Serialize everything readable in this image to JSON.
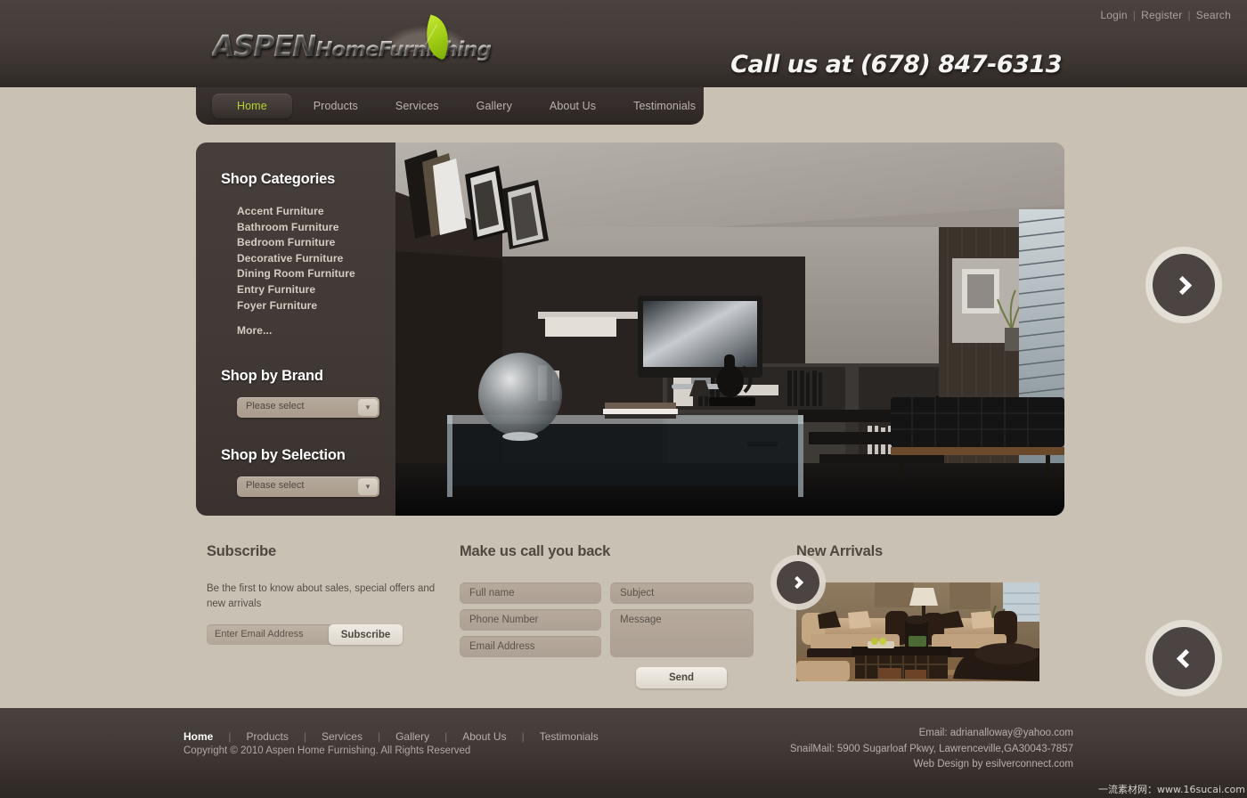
{
  "header": {
    "util_links": [
      {
        "label": "Login"
      },
      {
        "label": "Register"
      },
      {
        "label": "Search"
      }
    ],
    "separator": "|",
    "logo": {
      "primary": "ASPEN",
      "secondary": "HomeFurnishing"
    },
    "phone": "Call us at (678) 847-6313"
  },
  "nav": {
    "items": [
      {
        "label": "Home",
        "active": true
      },
      {
        "label": "Products",
        "active": false
      },
      {
        "label": "Services",
        "active": false
      },
      {
        "label": "Gallery",
        "active": false
      },
      {
        "label": "About Us",
        "active": false
      },
      {
        "label": "Testimonials",
        "active": false
      }
    ]
  },
  "sidebar": {
    "categories_title": "Shop Categories",
    "categories": [
      "Accent Furniture",
      "Bathroom Furniture",
      "Bedroom Furniture",
      "Decorative Furniture",
      "Dining Room Furniture",
      "Entry Furniture",
      "Foyer Furniture"
    ],
    "more_label": "More...",
    "brand_title": "Shop by Brand",
    "brand_select": {
      "value": "Please select",
      "caret": "▼"
    },
    "selection_title": "Shop by Selection",
    "selection_select": {
      "value": "Please select",
      "caret": "▼"
    }
  },
  "hero": {
    "next_label": "›",
    "prev_label": "‹"
  },
  "subscribe": {
    "title": "Subscribe",
    "description": "Be the first to know about sales, special offers and new arrivals",
    "input_placeholder": "Enter Email Address",
    "button_label": "Subscribe"
  },
  "callback": {
    "title": "Make us call you back",
    "fields": {
      "full_name": "Full name",
      "phone_number": "Phone Number",
      "email_address": "Email Address",
      "subject": "Subject",
      "message": "Message"
    },
    "send_label": "Send"
  },
  "arrivals": {
    "title": "New Arrivals",
    "next_label": "›"
  },
  "footer": {
    "nav": [
      "Home",
      "Products",
      "Services",
      "Gallery",
      "About Us",
      "Testimonials"
    ],
    "separator": "|",
    "copyright": "Copyright © 2010 Aspen Home Furnishing. All Rights Reserved",
    "email": "Email: adrianalloway@yahoo.com",
    "snailmail": "SnailMail: 5900 Sugarloaf Pkwy, Lawrenceville,GA30043-7857",
    "credit": "Web Design by esilverconnect.com"
  },
  "watermark": "一流素材网：www.16sucai.com",
  "colors": {
    "page_bg": "#c9c2b4",
    "header_dark": "#453d39",
    "accent_green": "#b4d42c",
    "link_green": "#93b81f",
    "field_bg": "#b2a698"
  }
}
